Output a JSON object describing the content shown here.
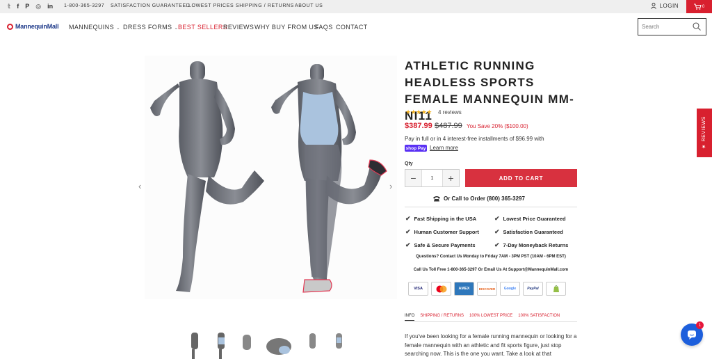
{
  "topbar": {
    "social_icons": [
      "twitter-icon",
      "facebook-icon",
      "pinterest-icon",
      "instagram-icon",
      "linkedin-icon"
    ],
    "phone": "1-800-365-3297",
    "links": [
      "SATISFACTION GUARANTEED",
      "LOWEST PRICES",
      "SHIPPING / RETURNS",
      "ABOUT US"
    ],
    "login": "LOGIN",
    "cart_count": "0"
  },
  "header": {
    "logo": "MannequinMall",
    "nav": [
      {
        "label": "MANNEQUINS",
        "dropdown": true
      },
      {
        "label": "DRESS FORMS",
        "dropdown": true
      },
      {
        "label": "BEST SELLERS",
        "highlight": true
      },
      {
        "label": "REVIEWS"
      },
      {
        "label": "WHY BUY FROM US"
      },
      {
        "label": "FAQS"
      },
      {
        "label": "CONTACT"
      }
    ],
    "search_placeholder": "Search"
  },
  "product": {
    "title": "ATHLETIC RUNNING HEADLESS SPORTS FEMALE MANNEQUIN MM-NI11",
    "rating": 5,
    "reviews_count": "4 reviews",
    "sale_price": "$387.99",
    "original_price": "$487.99",
    "savings": "You Save 20% ($100.00)",
    "installments": "Pay in full or in 4 interest-free installments of $96.99 with",
    "shop_pay": "shop Pay",
    "learn_more": "Learn more",
    "qty_label": "Qty",
    "qty_value": "1",
    "add_to_cart": "ADD TO CART",
    "call_to_order": "Or Call to Order (800) 365-3297",
    "features": [
      "Fast Shipping in the USA",
      "Lowest Price Guaranteed",
      "Human Customer Support",
      "Satisfaction Guaranteed",
      "Safe & Secure Payments",
      "7-Day Moneyback Returns"
    ],
    "questions": "Questions? Contact Us Monday to Friday 7AM - 3PM PST (10AM - 6PM EST)",
    "toll_free": "Call Us Toll Free 1-800-365-3297 Or Email Us At Support@MannequinMall.com",
    "payment_methods": [
      "VISA",
      "MasterCard",
      "AMEX",
      "DISCOVER",
      "Google",
      "PayPal",
      "Shopify"
    ],
    "tabs": [
      "INFO",
      "SHIPPING / RETURNS",
      "100% LOWEST PRICE",
      "100% SATISFACTION"
    ],
    "description": "If you've been looking for a female running mannequin or looking for a female mannequin with an athletic and fit sports figure, just stop searching now. This is the one you want. Take a look at that"
  },
  "side_tab": "★ REVIEWS",
  "chat_badge": "1",
  "colors": {
    "brand_red": "#d8202f",
    "logo_blue": "#1e3a8a",
    "shop_pay_purple": "#5a31f4",
    "chat_blue": "#1d5fdc"
  }
}
